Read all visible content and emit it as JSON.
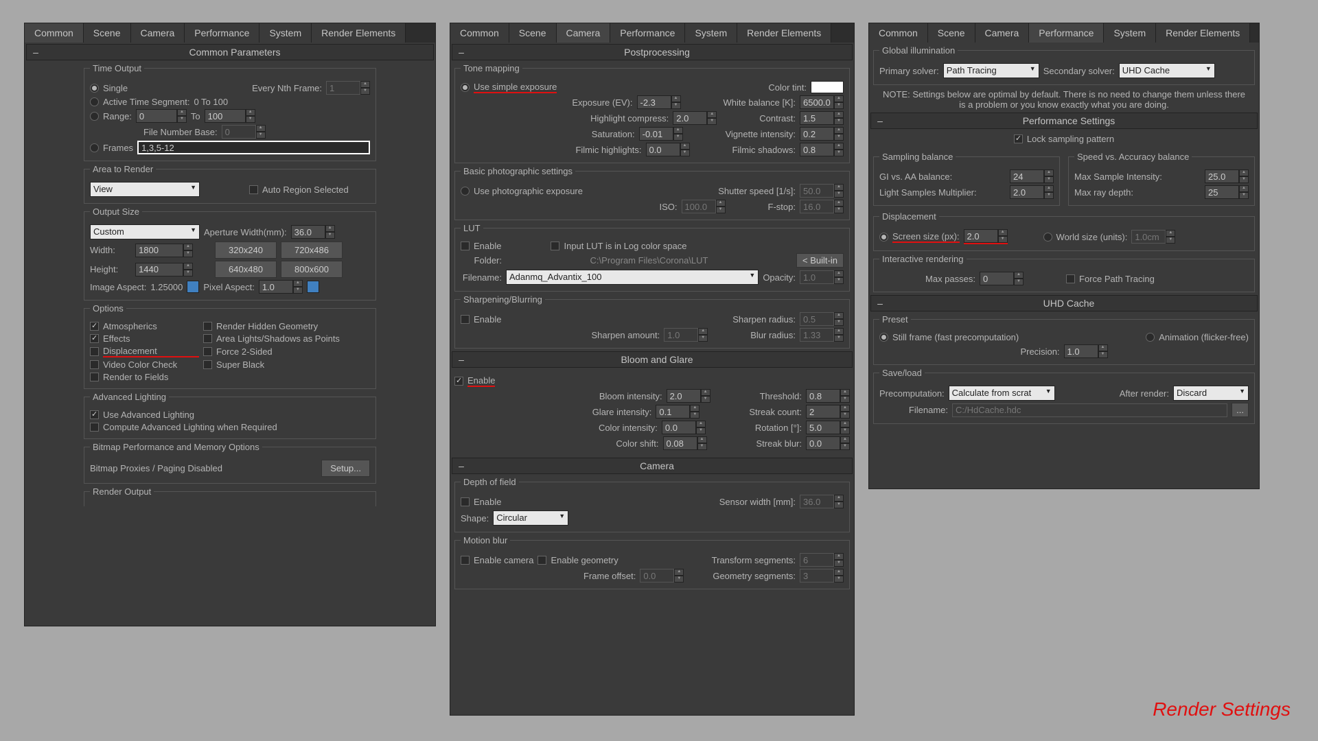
{
  "corner_label": "Render Settings",
  "tabs": [
    "Common",
    "Scene",
    "Camera",
    "Performance",
    "System",
    "Render Elements"
  ],
  "p1": {
    "active_tab": "Common",
    "hdr": "Common Parameters",
    "time_output": {
      "title": "Time Output",
      "single": "Single",
      "every_nth": "Every Nth Frame:",
      "every_nth_val": "1",
      "active_seg": "Active Time Segment:",
      "active_seg_range": "0 To 100",
      "range": "Range:",
      "range_from": "0",
      "range_to": "100",
      "to": "To",
      "file_num_base": "File Number Base:",
      "file_num_val": "0",
      "frames": "Frames",
      "frames_val": "1,3,5-12"
    },
    "area": {
      "title": "Area to Render",
      "value": "View",
      "auto": "Auto Region Selected"
    },
    "output": {
      "title": "Output Size",
      "custom": "Custom",
      "aperture": "Aperture Width(mm):",
      "aperture_val": "36.0",
      "width": "Width:",
      "width_val": "1800",
      "height": "Height:",
      "height_val": "1440",
      "p1": "320x240",
      "p2": "720x486",
      "p3": "640x480",
      "p4": "800x600",
      "aspect": "Image Aspect:",
      "aspect_val": "1.25000",
      "pixel_aspect": "Pixel Aspect:",
      "pixel_val": "1.0"
    },
    "options": {
      "title": "Options",
      "atmos": "Atmospherics",
      "effects": "Effects",
      "disp": "Displacement",
      "video": "Video Color Check",
      "render_fields": "Render to Fields",
      "hidden": "Render Hidden Geometry",
      "area_lights": "Area Lights/Shadows as Points",
      "force2": "Force 2-Sided",
      "super": "Super Black"
    },
    "adv": {
      "title": "Advanced Lighting",
      "use": "Use Advanced Lighting",
      "compute": "Compute Advanced Lighting when Required"
    },
    "bitmap": {
      "title": "Bitmap Performance and Memory Options",
      "proxies": "Bitmap Proxies / Paging Disabled",
      "setup": "Setup..."
    },
    "render_out": "Render Output"
  },
  "p2": {
    "active_tab": "Camera",
    "hdr": "Postprocessing",
    "tone": {
      "title": "Tone mapping",
      "use_simple": "Use simple exposure",
      "color_tint": "Color tint:",
      "exposure": "Exposure (EV):",
      "exposure_val": "-2.3",
      "white_bal": "White balance [K]:",
      "white_val": "6500.0",
      "hl_comp": "Highlight compress:",
      "hl_val": "2.0",
      "contrast": "Contrast:",
      "contrast_val": "1.5",
      "sat": "Saturation:",
      "sat_val": "-0.01",
      "vig": "Vignette intensity:",
      "vig_val": "0.2",
      "filmic_hl": "Filmic highlights:",
      "filmic_hl_val": "0.0",
      "filmic_sh": "Filmic shadows:",
      "filmic_sh_val": "0.8"
    },
    "basic": {
      "title": "Basic photographic settings",
      "use_photo": "Use photographic exposure",
      "shutter": "Shutter speed [1/s]:",
      "shutter_val": "50.0",
      "iso": "ISO:",
      "iso_val": "100.0",
      "fstop": "F-stop:",
      "fstop_val": "16.0"
    },
    "lut": {
      "title": "LUT",
      "enable": "Enable",
      "log": "Input LUT is in Log color space",
      "folder": "Folder:",
      "folder_val": "C:\\Program Files\\Corona\\LUT",
      "builtin": "< Built-in",
      "filename": "Filename:",
      "filename_val": "Adanmq_Advantix_100",
      "opacity": "Opacity:",
      "opacity_val": "1.0"
    },
    "sharp": {
      "title": "Sharpening/Blurring",
      "enable": "Enable",
      "sh_rad": "Sharpen radius:",
      "sh_rad_val": "0.5",
      "sh_amt": "Sharpen amount:",
      "sh_amt_val": "1.0",
      "bl_rad": "Blur radius:",
      "bl_rad_val": "1.33"
    },
    "bloom_hdr": "Bloom and Glare",
    "bloom": {
      "enable": "Enable",
      "intensity": "Bloom intensity:",
      "intensity_val": "2.0",
      "threshold": "Threshold:",
      "threshold_val": "0.8",
      "glare": "Glare intensity:",
      "glare_val": "0.1",
      "streak": "Streak count:",
      "streak_val": "2",
      "color_int": "Color intensity:",
      "color_int_val": "0.0",
      "rotation": "Rotation [°]:",
      "rotation_val": "5.0",
      "color_shift": "Color shift:",
      "color_shift_val": "0.08",
      "streak_blur": "Streak blur:",
      "streak_blur_val": "0.0"
    },
    "cam_hdr": "Camera",
    "dof": {
      "title": "Depth of field",
      "enable": "Enable",
      "sensor": "Sensor width [mm]:",
      "sensor_val": "36.0",
      "shape": "Shape:",
      "shape_val": "Circular"
    },
    "mb": {
      "title": "Motion blur",
      "enable_cam": "Enable camera",
      "enable_geo": "Enable geometry",
      "tseg": "Transform segments:",
      "tseg_val": "6",
      "foff": "Frame offset:",
      "foff_val": "0.0",
      "gseg": "Geometry segments:",
      "gseg_val": "3"
    }
  },
  "p3": {
    "active_tab": "Performance",
    "gi": {
      "title": "Global illumination",
      "primary": "Primary solver:",
      "primary_val": "Path Tracing",
      "secondary": "Secondary solver:",
      "secondary_val": "UHD Cache"
    },
    "note": "NOTE: Settings below are optimal by default. There is no need to change them unless there is a problem or you know exactly what you are doing.",
    "perf_hdr": "Performance Settings",
    "lock": "Lock sampling pattern",
    "sampling": {
      "title": "Sampling balance",
      "gi_aa": "GI vs. AA balance:",
      "gi_aa_val": "24",
      "lsm": "Light Samples Multiplier:",
      "lsm_val": "2.0"
    },
    "speed": {
      "title": "Speed vs. Accuracy balance",
      "msi": "Max Sample Intensity:",
      "msi_val": "25.0",
      "ray": "Max ray depth:",
      "ray_val": "25"
    },
    "disp": {
      "title": "Displacement",
      "screen": "Screen size (px):",
      "screen_val": "2.0",
      "world": "World size (units):",
      "world_val": "1.0cm"
    },
    "interactive": {
      "title": "Interactive rendering",
      "max_passes": "Max passes:",
      "max_passes_val": "0",
      "force": "Force Path Tracing"
    },
    "uhd_hdr": "UHD Cache",
    "preset": {
      "title": "Preset",
      "still": "Still frame (fast precomputation)",
      "anim": "Animation (flicker-free)",
      "precision": "Precision:",
      "precision_val": "1.0"
    },
    "saveload": {
      "title": "Save/load",
      "precomp": "Precomputation:",
      "precomp_val": "Calculate from scrat",
      "after": "After render:",
      "after_val": "Discard",
      "filename": "Filename:",
      "filename_val": "C:/HdCache.hdc",
      "browse": "..."
    }
  }
}
